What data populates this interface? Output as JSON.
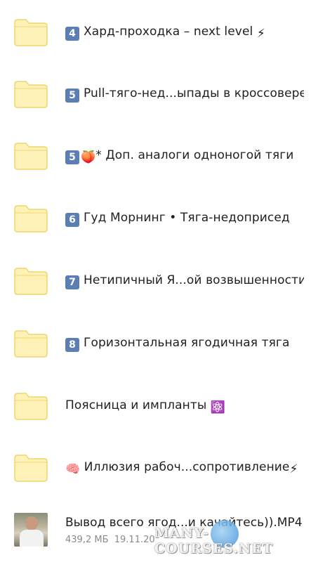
{
  "folders": [
    {
      "badge": "4",
      "text": "Хард-проходка – next level",
      "emoji": "⚡"
    },
    {
      "badge": "5",
      "text": "Pull-тяго-нед...ыпады в кроссовере",
      "emoji": ""
    },
    {
      "badge": "5",
      "text": "* Доп. аналоги одноногой тяги",
      "emoji": "🍑"
    },
    {
      "badge": "6",
      "text": "Гуд Морнинг • Тяга-недоприсед",
      "emoji": ""
    },
    {
      "badge": "7",
      "text": "Нетипичный Я...ой возвышенности",
      "emoji": ""
    },
    {
      "badge": "8",
      "text": "Горизонтальная ягодичная тяга",
      "emoji": ""
    },
    {
      "badge": "",
      "text": "Поясница и импланты",
      "emoji": "⚛️"
    },
    {
      "badge": "",
      "text": "Иллюзия рабоч...сопротивление",
      "emoji": "⚡",
      "lead_emoji": "🧠"
    }
  ],
  "file": {
    "name": "Вывод всего ягод...и качайтесь)).MP4",
    "size": "439,2 МБ",
    "date": "19.11.20"
  },
  "watermark": "MANY-COURSES.NET",
  "colors": {
    "folder_fill": "#fff2b8",
    "folder_stroke": "#f0d66b",
    "badge": "#5b7fb5"
  }
}
